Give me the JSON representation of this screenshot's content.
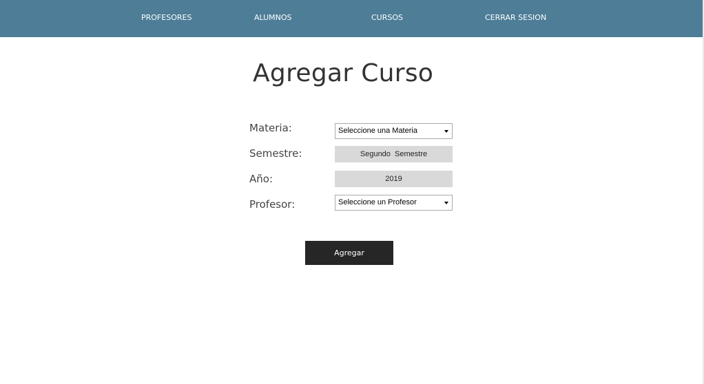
{
  "colors": {
    "navbar": "#4d7d97",
    "button": "#262626",
    "readonly_field": "#d9d9d9"
  },
  "nav": {
    "items": [
      {
        "label": "PROFESORES"
      },
      {
        "label": "ALUMNOS"
      },
      {
        "label": "CURSOS"
      },
      {
        "label": "CERRAR SESION"
      }
    ]
  },
  "page": {
    "title": "Agregar Curso"
  },
  "form": {
    "materia": {
      "label": "Materia:",
      "value": "Seleccione una Materia"
    },
    "semestre": {
      "label": "Semestre:",
      "value": "Segundo  Semestre"
    },
    "anio": {
      "label": "Año:",
      "value": "2019"
    },
    "profesor": {
      "label": "Profesor:",
      "value": "Seleccione un Profesor"
    },
    "submit_label": "Agregar"
  }
}
